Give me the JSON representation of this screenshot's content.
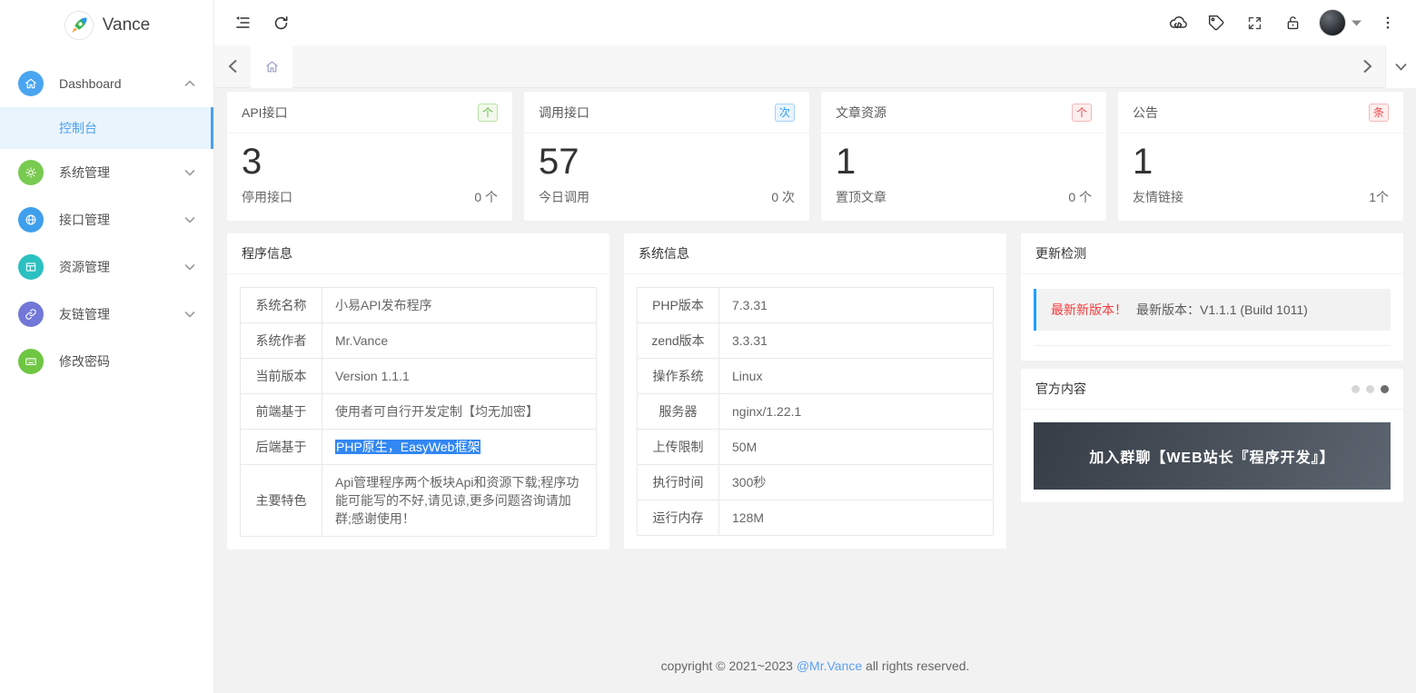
{
  "app": {
    "name": "Vance"
  },
  "colors": {
    "accent_blue": "#1e9fff",
    "active_item_bg": "#e9f4fd",
    "green": "#77c94f",
    "teal": "#2cc0c0",
    "purple": "#7277d8",
    "badge_green": "#64bb45",
    "badge_blue": "#2e9df2",
    "badge_red": "#e84a4a",
    "banner_dark": "#363d46"
  },
  "sidebar": {
    "items": [
      {
        "label": "Dashboard",
        "icon": "home-icon",
        "expanded": true,
        "children": [
          {
            "label": "控制台",
            "active": true
          }
        ]
      },
      {
        "label": "系统管理",
        "icon": "gear-icon"
      },
      {
        "label": "接口管理",
        "icon": "globe-icon"
      },
      {
        "label": "资源管理",
        "icon": "table-icon"
      },
      {
        "label": "友链管理",
        "icon": "link-icon"
      },
      {
        "label": "修改密码",
        "icon": "keyboard-icon"
      }
    ]
  },
  "header": {
    "left_icons": [
      "collapse-sidebar-icon",
      "refresh-icon"
    ],
    "right_icons": [
      "cloud-code-icon",
      "tag-icon",
      "fullscreen-icon",
      "lock-icon",
      "avatar",
      "more-vertical-icon"
    ]
  },
  "tabbar": {
    "icons": [
      "chevron-left-icon",
      "home-tab-icon",
      "chevron-right-icon",
      "chevron-down-icon"
    ]
  },
  "stats": [
    {
      "title": "API接口",
      "unit": "个",
      "value": "3",
      "foot_label": "停用接口",
      "foot_value": "0 个"
    },
    {
      "title": "调用接口",
      "unit": "次",
      "value": "57",
      "foot_label": "今日调用",
      "foot_value": "0 次"
    },
    {
      "title": "文章资源",
      "unit": "个",
      "value": "1",
      "foot_label": "置顶文章",
      "foot_value": "0 个"
    },
    {
      "title": "公告",
      "unit": "条",
      "value": "1",
      "foot_label": "友情链接",
      "foot_value": "1个"
    }
  ],
  "program_info": {
    "title": "程序信息",
    "rows": [
      {
        "label": "系统名称",
        "value": "小易API发布程序"
      },
      {
        "label": "系统作者",
        "value": "Mr.Vance"
      },
      {
        "label": "当前版本",
        "value": "Version 1.1.1"
      },
      {
        "label": "前端基于",
        "value": "使用者可自行开发定制【均无加密】"
      },
      {
        "label": "后端基于",
        "value": "PHP原生，EasyWeb框架",
        "selected": true
      },
      {
        "label": "主要特色",
        "value": "Api管理程序两个板块Api和资源下载;程序功能可能写的不好,请见谅,更多问题咨询请加群;感谢使用！"
      }
    ]
  },
  "system_info": {
    "title": "系统信息",
    "rows": [
      {
        "label": "PHP版本",
        "value": "7.3.31"
      },
      {
        "label": "zend版本",
        "value": "3.3.31"
      },
      {
        "label": "操作系统",
        "value": "Linux"
      },
      {
        "label": "服务器",
        "value": "nginx/1.22.1"
      },
      {
        "label": "上传限制",
        "value": "50M"
      },
      {
        "label": "执行时间",
        "value": "300秒"
      },
      {
        "label": "运行内存",
        "value": "128M"
      }
    ]
  },
  "update_check": {
    "title": "更新检测",
    "alert_highlight": "最新新版本！",
    "alert_text": "最新版本：V1.1.1 (Build 1011)"
  },
  "official": {
    "title": "官方内容",
    "banner_text": "加入群聊【WEB站长『程序开发』】",
    "dots_total": 3,
    "active_dot_index": 2
  },
  "footer": {
    "text_before": "copyright © 2021~2023 ",
    "link_text": "@Mr.Vance",
    "text_after": " all rights reserved."
  }
}
